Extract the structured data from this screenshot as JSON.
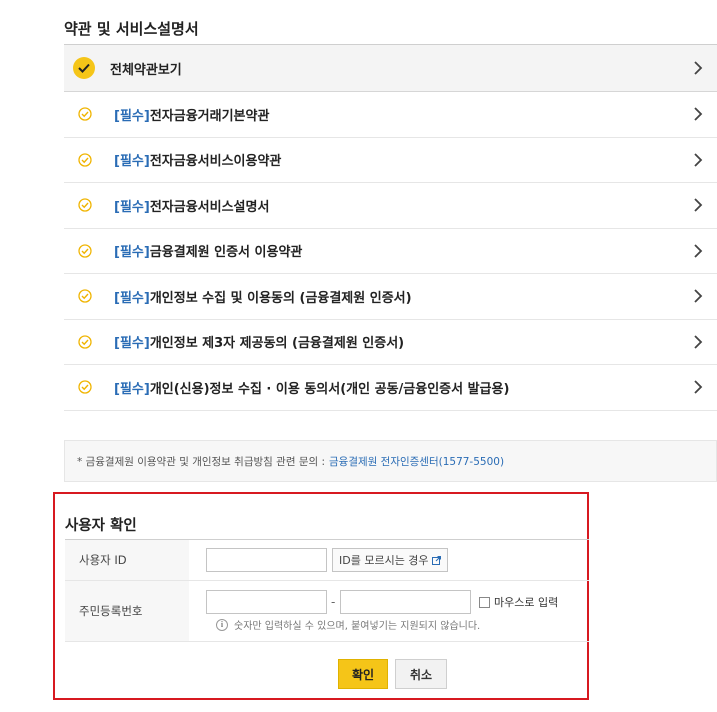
{
  "section_title": "약관 및 서비스설명서",
  "terms": {
    "all_label": "전체약관보기",
    "items": [
      {
        "tag": "[필수]",
        "label": "전자금융거래기본약관"
      },
      {
        "tag": "[필수]",
        "label": "전자금융서비스이용약관"
      },
      {
        "tag": "[필수]",
        "label": "전자금융서비스설명서"
      },
      {
        "tag": "[필수]",
        "label": "금융결제원 인증서 이용약관"
      },
      {
        "tag": "[필수]",
        "label": "개인정보 수집 및 이용동의 (금융결제원 인증서)"
      },
      {
        "tag": "[필수]",
        "label": "개인정보 제3자 제공동의 (금융결제원 인증서)"
      },
      {
        "tag": "[필수]",
        "label": "개인(신용)정보 수집 · 이용 동의서(개인 공동/금융인증서 발급용)"
      }
    ]
  },
  "notice": {
    "text": "* 금융결제원 이용약관 및 개인정보 취급방침 관련 문의 :",
    "link": "금융결제원 전자인증센터(1577-5500)"
  },
  "verify": {
    "title": "사용자 확인",
    "id_label": "사용자 ID",
    "id_value": "",
    "find_id_button": "ID를 모르시는 경우",
    "rrn_label": "주민등록번호",
    "rrn_front": "",
    "rrn_dash": "-",
    "rrn_back": "",
    "mouse_input_label": "마우스로 입력",
    "hint": "숫자만 입력하실 수 있으며, 붙여넣기는 지원되지 않습니다.",
    "ok_button": "확인",
    "cancel_button": "취소"
  },
  "colors": {
    "accent_yellow": "#f5c518",
    "link_blue": "#2a6cb5",
    "highlight_red": "#d71920"
  },
  "icons": {
    "check_all": "check-circle-filled-icon",
    "check_item": "check-circle-outline-icon",
    "chevron": "chevron-right-icon",
    "external": "external-link-icon",
    "info": "info-icon"
  }
}
